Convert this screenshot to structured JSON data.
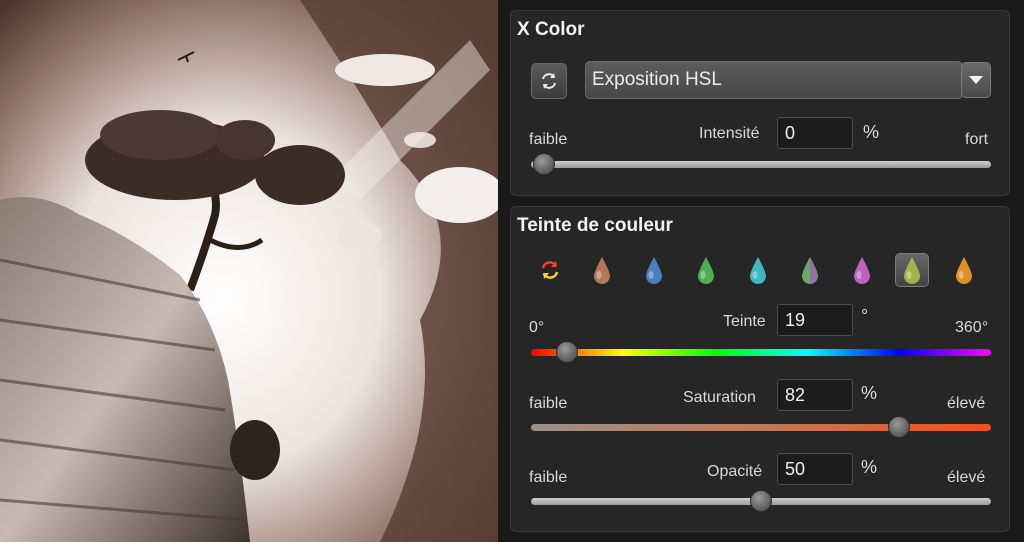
{
  "xcolor": {
    "title": "X Color",
    "refresh_icon": "refresh-icon",
    "preset_value": "Exposition HSL",
    "intensity": {
      "low": "faible",
      "label": "Intensité",
      "value": "0",
      "unit": "%",
      "high": "fort",
      "level": 0
    }
  },
  "tint": {
    "title": "Teinte de couleur",
    "presets": [
      {
        "name": "random-color-icon"
      },
      {
        "name": "brown-drop-icon",
        "color": "#b07a5a"
      },
      {
        "name": "blue-drop-icon",
        "color": "#4a7fc0"
      },
      {
        "name": "green-drop-icon",
        "color": "#4caf50"
      },
      {
        "name": "cyan-drop-icon",
        "color": "#3fb6c2"
      },
      {
        "name": "green-purple-drop-icon",
        "color": "#6aa86a"
      },
      {
        "name": "magenta-drop-icon",
        "color": "#c060c0"
      },
      {
        "name": "yellow-green-drop-icon",
        "color": "#a8b04a",
        "active": true
      },
      {
        "name": "orange-drop-icon",
        "color": "#e0902a"
      }
    ],
    "hue": {
      "low": "0°",
      "label": "Teinte",
      "value": "19",
      "unit": "°",
      "high": "360°",
      "level": 0.053
    },
    "saturation": {
      "low": "faible",
      "label": "Saturation",
      "value": "82",
      "unit": "%",
      "high": "élevé",
      "level": 0.82
    },
    "opacity": {
      "low": "faible",
      "label": "Opacité",
      "value": "50",
      "unit": "%",
      "high": "élevé",
      "level": 0.5
    }
  },
  "colors": {
    "accent_orange": "#e8602a",
    "panel_bg": "#262626"
  }
}
